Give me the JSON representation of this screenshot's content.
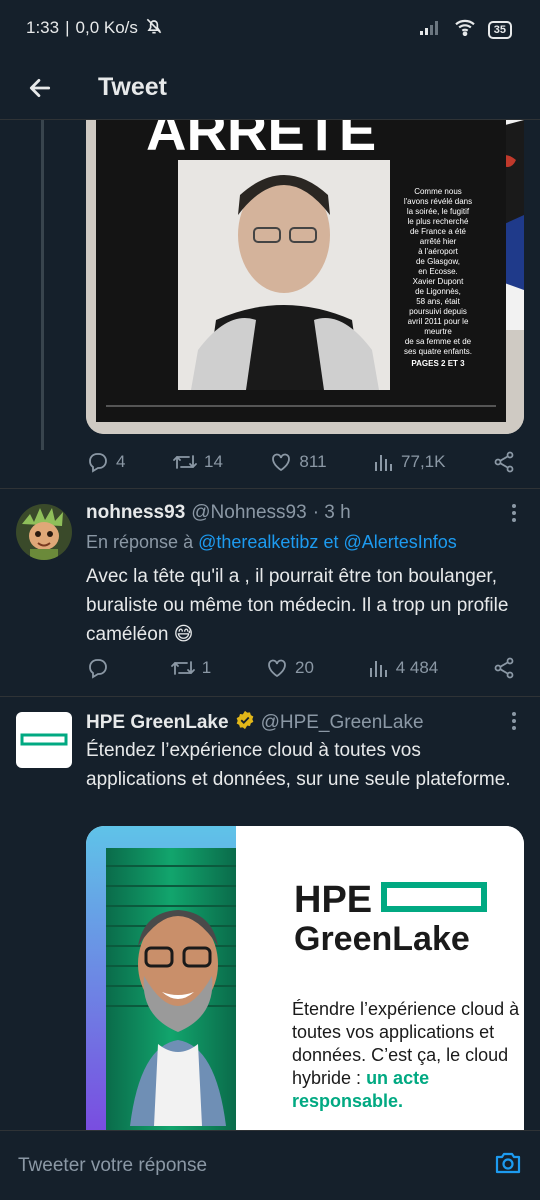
{
  "status_bar": {
    "time": "1:33",
    "net_speed": "0,0 Ko/s",
    "battery": "35"
  },
  "header": {
    "title": "Tweet"
  },
  "tweets": [
    {
      "stats": {
        "replies": "4",
        "retweets": "14",
        "likes": "811",
        "views": "77,1K"
      },
      "image_text": {
        "headline": "ARRÊTÉ",
        "caption_lines": [
          "Comme nous",
          "l'avons révélé dans",
          "la soirée, le fugitif",
          "le plus recherché",
          "de France a été",
          "arrêté hier",
          "à l'aéroport",
          "de Glasgow,",
          "en Ecosse.",
          "Xavier Dupont",
          "de Ligonnès,",
          "58 ans, était",
          "poursuivi depuis",
          "avril 2011 pour le",
          "meurtre",
          "de sa femme et de",
          "ses quatre enfants."
        ],
        "pages": "PAGES 2 ET 3"
      }
    },
    {
      "name": "nohness93",
      "handle": "@Nohness93",
      "time": "· 3 h",
      "reply_prefix": "En réponse à",
      "reply_to_1": "@therealketibz",
      "reply_and": "et",
      "reply_to_2": "@AlertesInfos",
      "text": "Avec la tête qu'il a , il pourrait être ton boulanger, buraliste ou même ton médecin.  Il a trop un profile caméléon 😅",
      "stats": {
        "replies": "",
        "retweets": "1",
        "likes": "20",
        "views": "4 484"
      }
    },
    {
      "name": "HPE GreenLake",
      "handle": "@HPE_GreenLake",
      "text": "Étendez l’expérience cloud à toutes vos applications et données, sur une seule plateforme.",
      "ad": {
        "brand_1": "HPE",
        "brand_2": "GreenLake",
        "copy": "Étendre l’expérience cloud à toutes vos applications et données. C’est ça, le cloud hybride :",
        "copy_highlight": "un acte responsable."
      }
    }
  ],
  "reply_bar": {
    "placeholder": "Tweeter votre réponse"
  },
  "colors": {
    "background": "#15202b",
    "accent": "#1d9bf0",
    "secondary_text": "#8b98a5",
    "hpe_green": "#01a982"
  }
}
